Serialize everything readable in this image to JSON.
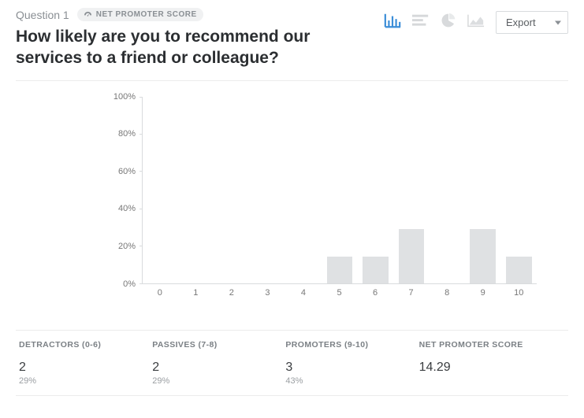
{
  "meta": {
    "qnum": "Question 1",
    "badge": "NET PROMOTER SCORE"
  },
  "question": "How likely are you to recommend our services to a friend or colleague?",
  "toolbar": {
    "export_label": "Export"
  },
  "chart_data": {
    "type": "bar",
    "categories": [
      "0",
      "1",
      "2",
      "3",
      "4",
      "5",
      "6",
      "7",
      "8",
      "9",
      "10"
    ],
    "values": [
      0,
      0,
      0,
      0,
      0,
      14,
      14,
      29,
      0,
      29,
      14
    ],
    "ylabel": "",
    "ylim": [
      0,
      100
    ],
    "yticks": [
      0,
      20,
      40,
      60,
      80,
      100
    ],
    "ytick_labels": [
      "0%",
      "20%",
      "40%",
      "60%",
      "80%",
      "100%"
    ]
  },
  "summary": {
    "detractors": {
      "label": "DETRACTORS (0-6)",
      "count": "2",
      "pct": "29%"
    },
    "passives": {
      "label": "PASSIVES (7-8)",
      "count": "2",
      "pct": "29%"
    },
    "promoters": {
      "label": "PROMOTERS (9-10)",
      "count": "3",
      "pct": "43%"
    },
    "nps": {
      "label": "NET PROMOTER SCORE",
      "value": "14.29"
    }
  }
}
